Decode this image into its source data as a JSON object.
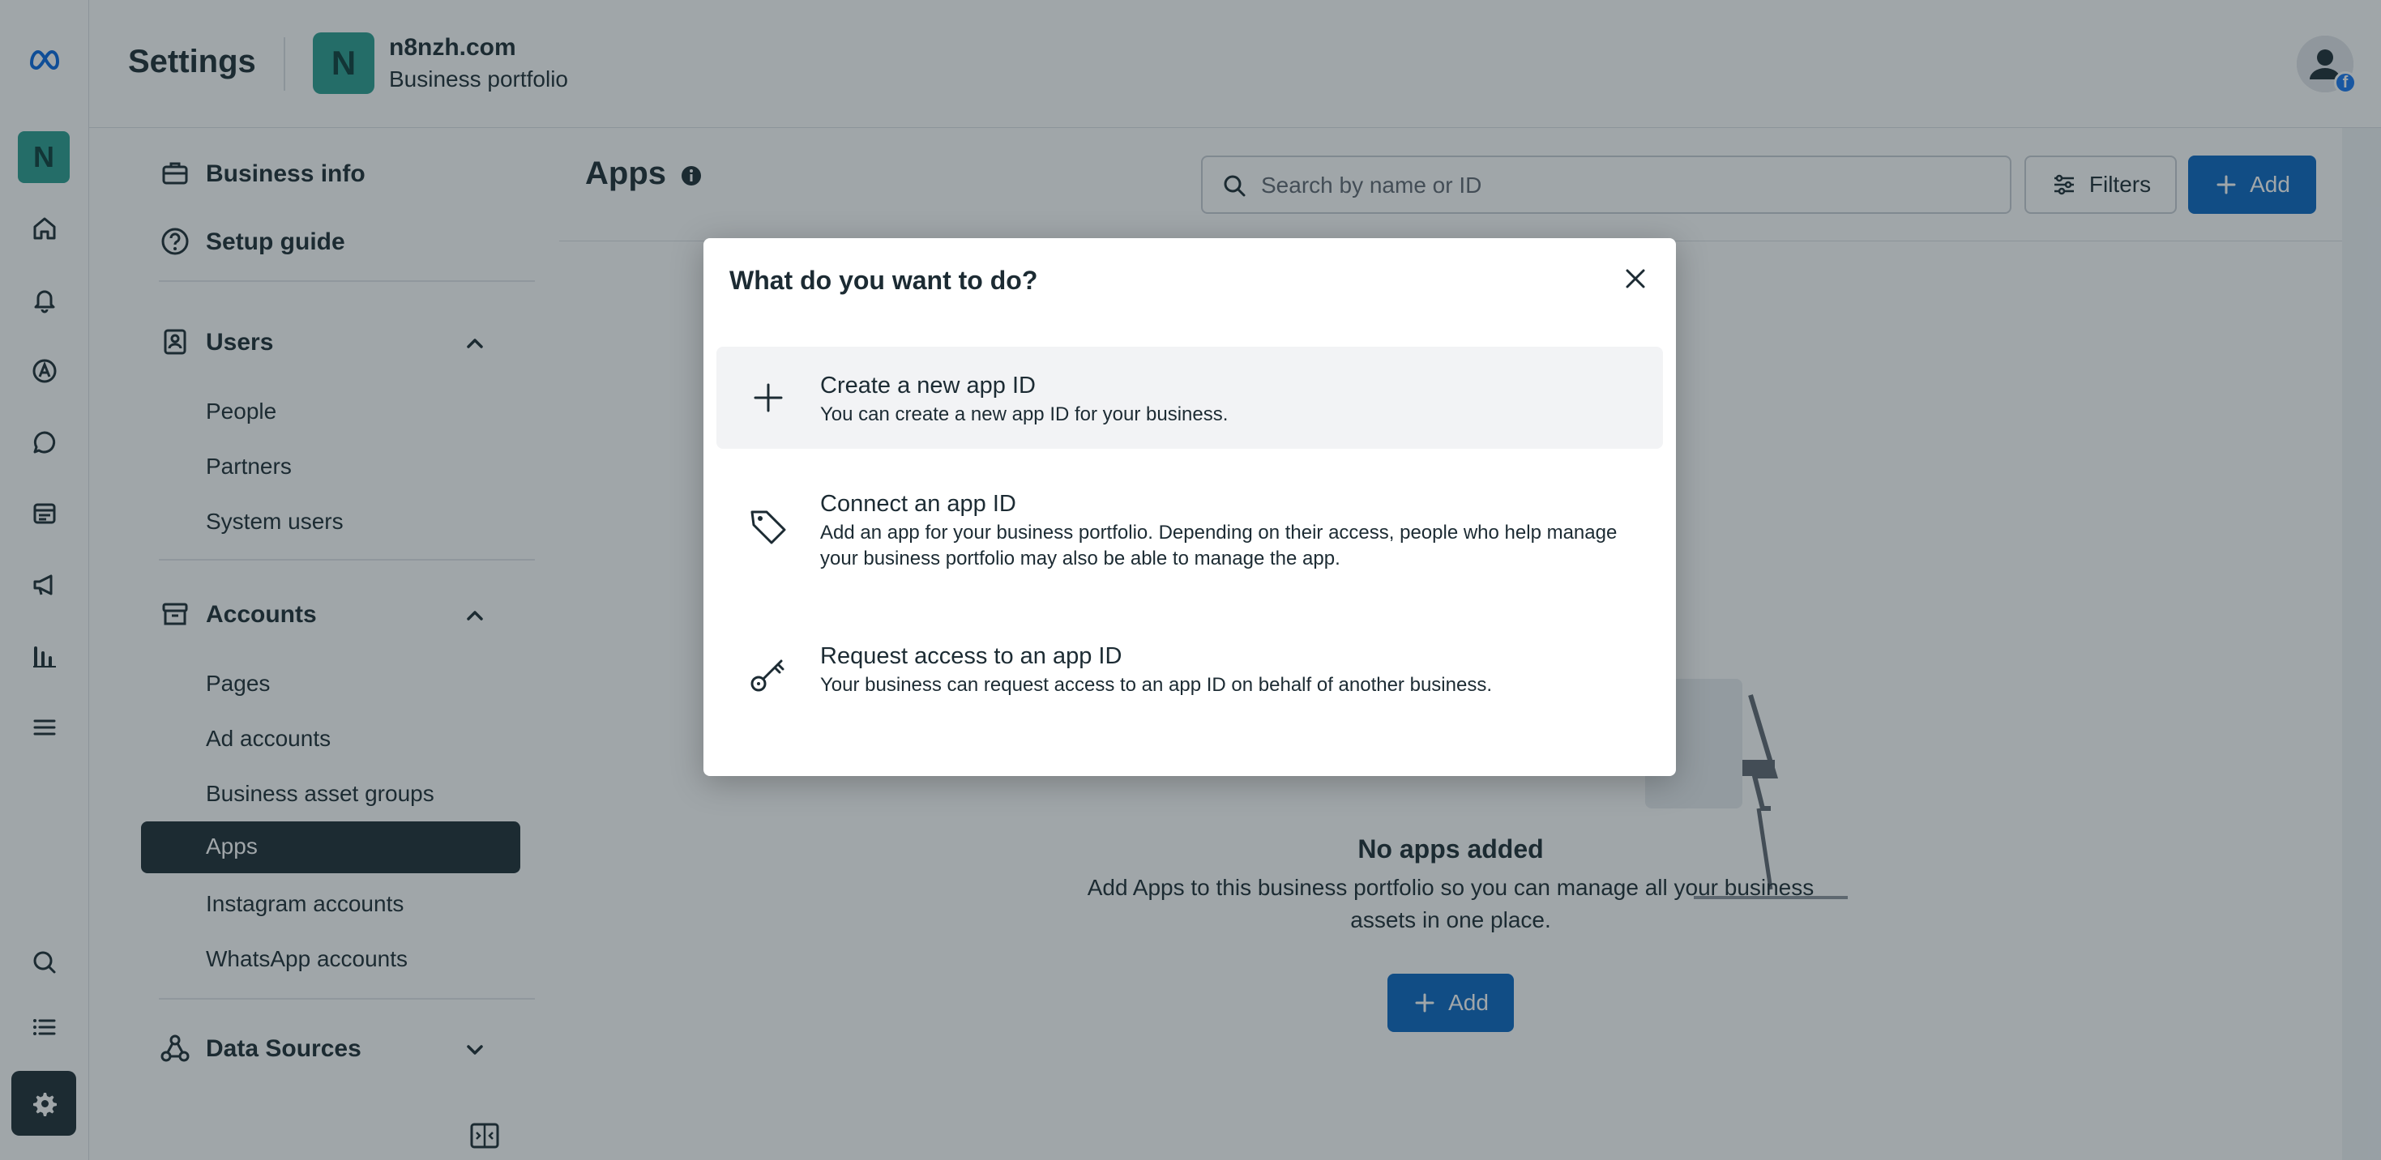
{
  "header": {
    "settings_title": "Settings",
    "business_initial": "N",
    "business_name": "n8nzh.com",
    "business_subtitle": "Business portfolio"
  },
  "rail": {
    "avatar_initial": "N",
    "items": [
      "meta-logo-icon",
      "home-icon",
      "notifications-icon",
      "ads-manager-icon",
      "inbox-icon",
      "content-icon",
      "campaign-icon",
      "insights-icon",
      "menu-icon",
      "search-icon",
      "list-icon",
      "settings-icon"
    ]
  },
  "nav": {
    "business_info": "Business info",
    "setup_guide": "Setup guide",
    "users": {
      "label": "Users",
      "items": [
        "People",
        "Partners",
        "System users"
      ]
    },
    "accounts": {
      "label": "Accounts",
      "items": [
        "Pages",
        "Ad accounts",
        "Business asset groups",
        "Apps",
        "Instagram accounts",
        "WhatsApp accounts"
      ]
    },
    "data_sources": "Data Sources"
  },
  "main": {
    "title": "Apps",
    "search_placeholder": "Search by name or ID",
    "filters_label": "Filters",
    "add_label": "Add",
    "empty_title": "No apps added",
    "empty_desc": "Add Apps to this business portfolio so you can manage all your business assets in one place.",
    "empty_add_label": "Add"
  },
  "modal": {
    "title": "What do you want to do?",
    "options": [
      {
        "title": "Create a new app ID",
        "desc": "You can create a new app ID for your business.",
        "icon": "plus-icon"
      },
      {
        "title": "Connect an app ID",
        "desc": "Add an app for your business portfolio. Depending on their access, people who help manage your business portfolio may also be able to manage the app.",
        "icon": "tag-icon"
      },
      {
        "title": "Request access to an app ID",
        "desc": "Your business can request access to an app ID on behalf of another business.",
        "icon": "key-icon"
      }
    ]
  },
  "colors": {
    "primary_blue": "#0a66c2",
    "dark": "#1c2b33",
    "avatar_teal": "#2a9d8f"
  }
}
